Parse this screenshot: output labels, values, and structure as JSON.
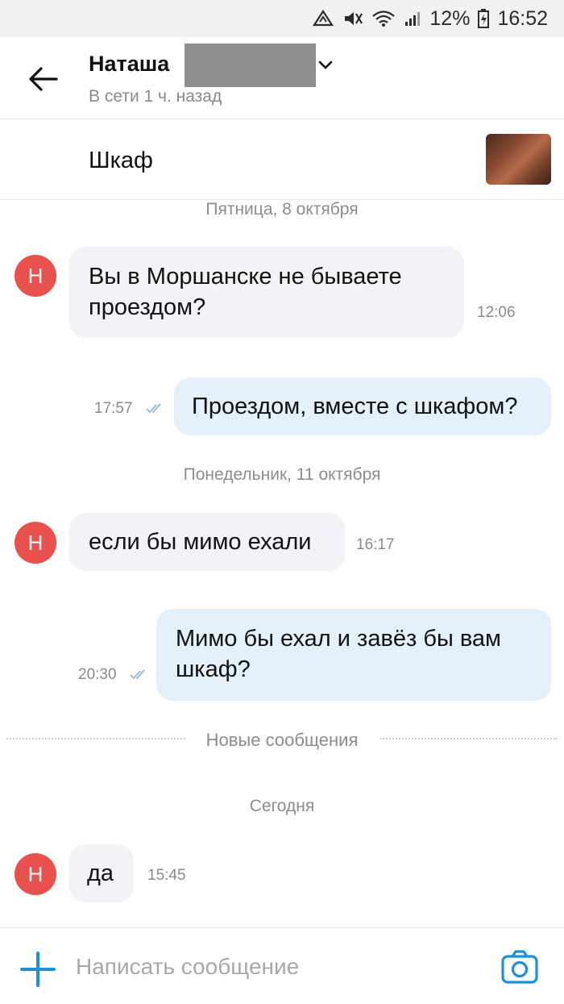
{
  "status_bar": {
    "battery_percent": "12%",
    "clock": "16:52",
    "icons": [
      "data-saver-icon",
      "mute-icon",
      "wifi-icon",
      "signal-icon",
      "battery-icon"
    ]
  },
  "header": {
    "contact_name": "Наташа",
    "presence": "В сети 1 ч. назад"
  },
  "listing": {
    "title": "Шкаф"
  },
  "messages": [
    {
      "type": "date",
      "text": "Пятница, 8 октября"
    },
    {
      "type": "in",
      "avatar": "Н",
      "text": "Вы в Моршанске не бываете проездом?",
      "time": "12:06"
    },
    {
      "type": "out",
      "text": "Проездом, вместе с шкафом?",
      "time": "17:57",
      "read": true
    },
    {
      "type": "date",
      "text": "Понедельник, 11 октября"
    },
    {
      "type": "in",
      "avatar": "Н",
      "text": "если бы мимо ехали",
      "time": "16:17"
    },
    {
      "type": "out",
      "text": "Мимо бы ехал и завёз бы вам шкаф?",
      "time": "20:30",
      "read": true
    },
    {
      "type": "divider",
      "text": "Новые сообщения"
    },
    {
      "type": "date",
      "text": "Сегодня"
    },
    {
      "type": "in",
      "avatar": "Н",
      "text": "да",
      "time": "15:45"
    }
  ],
  "input": {
    "placeholder": "Написать сообщение"
  },
  "colors": {
    "accent": "#1e90d6",
    "avatar": "#e8514e",
    "bubble_in": "#f3f2f6",
    "bubble_out": "#e4f1fb"
  }
}
